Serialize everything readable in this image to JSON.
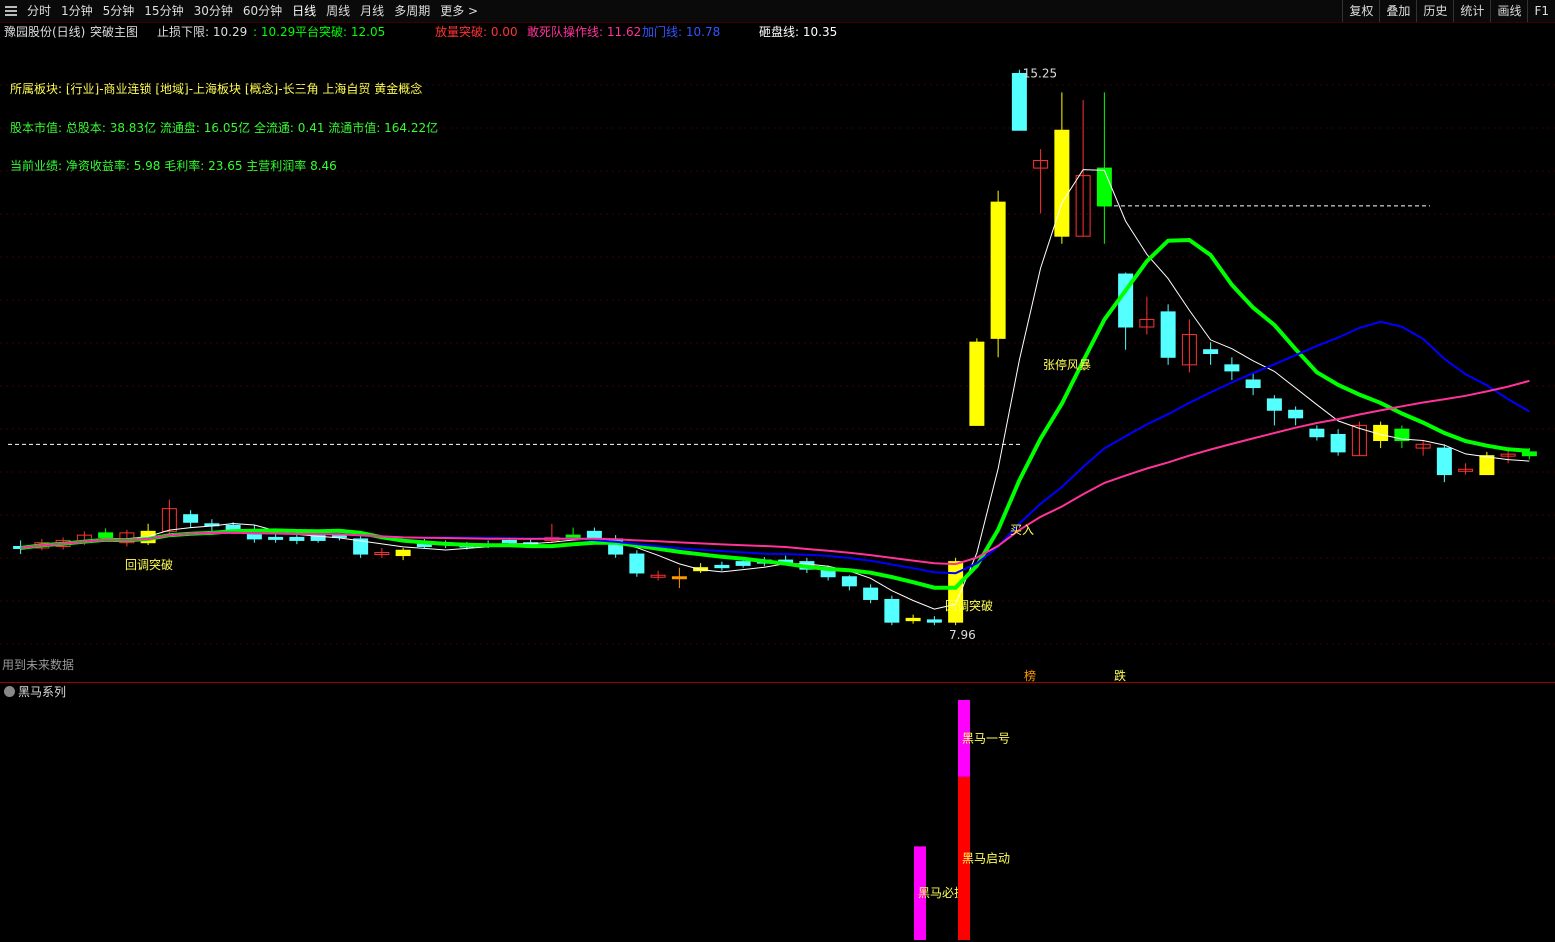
{
  "toolbar": {
    "periods": [
      "分时",
      "1分钟",
      "5分钟",
      "15分钟",
      "30分钟",
      "60分钟",
      "日线",
      "周线",
      "月线",
      "多周期",
      "更多 >"
    ],
    "active_period": "日线",
    "right_buttons": [
      "复权",
      "叠加",
      "历史",
      "统计",
      "画线",
      "F1"
    ]
  },
  "info": {
    "stock": "豫园股份(日线)",
    "indicator": "突破主图",
    "stop_loss": "止损下限: 10.29",
    "support": ": 10.29",
    "platform_breakout": "平台突破: 12.05",
    "volume_breakout": "放量突破: 0.00",
    "dare_line": "敢死队操作线: 11.62",
    "accelerate_line": "加门线: 10.78",
    "smash_line": "砸盘线: 10.35"
  },
  "notes": {
    "sector": "所属板块: [行业]-商业连锁 [地域]-上海板块 [概念]-长三角 上海自贸 黄金概念",
    "capital": "股本市值: 总股本: 38.83亿 流通盘: 16.05亿 全流通: 0.41 流通市值: 164.22亿",
    "performance": "当前业绩: 净资收益率: 5.98 毛利率: 23.65 主营利润率 8.46"
  },
  "future_data_note": "用到未来数据",
  "sub_panel_title": "黑马系列",
  "colors": {
    "up_candle": "#ff3232",
    "down_candle": "#54ffff",
    "yellow": "#ffff00",
    "green_line": "#00ff00",
    "blue_line": "#0000ff",
    "pink_line": "#ff3399",
    "magenta": "#ff00ff",
    "red_bar": "#ff0000"
  },
  "chart_data": {
    "type": "candlestick",
    "y_range": [
      7.5,
      15.6
    ],
    "high_label": "15.25",
    "low_label": "7.96",
    "dashed_levels": [
      10.35,
      13.5
    ],
    "candles": [
      [
        9.0,
        8.98,
        9.08,
        8.9
      ],
      [
        8.98,
        9.05,
        9.1,
        8.95
      ],
      [
        9.0,
        9.08,
        9.12,
        8.96
      ],
      [
        9.06,
        9.15,
        9.2,
        9.02
      ],
      [
        9.12,
        9.18,
        9.24,
        9.08
      ],
      [
        9.18,
        9.05,
        9.22,
        9.0
      ],
      [
        9.05,
        9.2,
        9.3,
        9.02
      ],
      [
        9.2,
        9.5,
        9.62,
        9.15
      ],
      [
        9.42,
        9.32,
        9.48,
        9.25
      ],
      [
        9.3,
        9.28,
        9.36,
        9.2
      ],
      [
        9.28,
        9.22,
        9.32,
        9.18
      ],
      [
        9.22,
        9.1,
        9.28,
        9.05
      ],
      [
        9.1,
        9.12,
        9.18,
        9.05
      ],
      [
        9.12,
        9.08,
        9.16,
        9.03
      ],
      [
        9.08,
        9.15,
        9.2,
        9.05
      ],
      [
        9.15,
        9.12,
        9.18,
        9.08
      ],
      [
        9.1,
        8.9,
        9.15,
        8.85
      ],
      [
        8.9,
        8.92,
        8.98,
        8.85
      ],
      [
        8.95,
        8.88,
        8.98,
        8.82
      ],
      [
        9.0,
        9.05,
        9.1,
        8.98
      ],
      [
        9.05,
        9.02,
        9.08,
        8.98
      ],
      [
        9.02,
        9.0,
        9.06,
        8.96
      ],
      [
        9.0,
        9.03,
        9.08,
        8.98
      ],
      [
        9.05,
        9.08,
        9.12,
        9.0
      ],
      [
        9.02,
        9.05,
        9.1,
        9.0
      ],
      [
        9.08,
        9.12,
        9.3,
        9.05
      ],
      [
        9.12,
        9.15,
        9.25,
        9.1
      ],
      [
        9.2,
        9.1,
        9.25,
        9.05
      ],
      [
        9.1,
        8.9,
        9.15,
        8.85
      ],
      [
        8.9,
        8.65,
        8.95,
        8.6
      ],
      [
        8.6,
        8.62,
        8.68,
        8.55
      ],
      [
        8.6,
        8.58,
        8.72,
        8.45
      ],
      [
        8.68,
        8.72,
        8.78,
        8.65
      ],
      [
        8.72,
        8.75,
        8.8,
        8.68
      ],
      [
        8.75,
        8.8,
        8.85,
        8.72
      ],
      [
        8.82,
        8.78,
        8.86,
        8.74
      ],
      [
        8.78,
        8.82,
        8.88,
        8.75
      ],
      [
        8.8,
        8.7,
        8.85,
        8.65
      ],
      [
        8.7,
        8.6,
        8.75,
        8.55
      ],
      [
        8.6,
        8.48,
        8.62,
        8.42
      ],
      [
        8.45,
        8.3,
        8.5,
        8.25
      ],
      [
        8.3,
        8.0,
        8.35,
        7.96
      ],
      [
        8.02,
        8.05,
        8.1,
        7.98
      ],
      [
        8.0,
        8.03,
        8.08,
        7.96
      ],
      [
        8.0,
        8.8,
        8.85,
        7.96
      ],
      [
        10.6,
        11.7,
        11.75,
        10.6
      ],
      [
        11.75,
        13.55,
        13.7,
        11.5
      ],
      [
        14.5,
        15.25,
        15.3,
        14.5
      ],
      [
        14.0,
        14.1,
        14.25,
        13.4
      ],
      [
        14.5,
        13.1,
        15.0,
        13.0
      ],
      [
        13.1,
        13.9,
        14.9,
        13.1
      ],
      [
        14.0,
        13.5,
        15.0,
        13.0
      ],
      [
        12.6,
        11.9,
        12.62,
        11.6
      ],
      [
        12.0,
        11.9,
        12.3,
        11.8
      ],
      [
        12.1,
        11.5,
        12.2,
        11.4
      ],
      [
        11.4,
        11.8,
        12.0,
        11.3
      ],
      [
        11.6,
        11.55,
        11.7,
        11.4
      ],
      [
        11.4,
        11.32,
        11.5,
        11.2
      ],
      [
        11.2,
        11.1,
        11.3,
        11.0
      ],
      [
        10.95,
        10.8,
        11.0,
        10.6
      ],
      [
        10.8,
        10.7,
        10.85,
        10.6
      ],
      [
        10.55,
        10.45,
        10.6,
        10.4
      ],
      [
        10.48,
        10.25,
        10.55,
        10.2
      ],
      [
        10.2,
        10.6,
        10.65,
        10.2
      ],
      [
        10.6,
        10.4,
        10.65,
        10.3
      ],
      [
        10.55,
        10.4,
        10.6,
        10.3
      ],
      [
        10.3,
        10.35,
        10.4,
        10.2
      ],
      [
        10.3,
        9.95,
        10.35,
        9.85
      ],
      [
        10.0,
        10.02,
        10.1,
        9.95
      ],
      [
        9.95,
        10.2,
        10.25,
        9.95
      ],
      [
        10.2,
        10.22,
        10.28,
        10.1
      ],
      [
        10.2,
        10.25,
        10.3,
        10.15
      ]
    ],
    "candle_colors": [
      "d",
      "u",
      "u",
      "u",
      "g",
      "u",
      "y",
      "u",
      "d",
      "d",
      "d",
      "d",
      "d",
      "d",
      "d",
      "d",
      "d",
      "u",
      "y",
      "d",
      "d",
      "d",
      "d",
      "d",
      "d",
      "u",
      "g",
      "d",
      "d",
      "d",
      "u",
      "o",
      "y",
      "d",
      "d",
      "d",
      "d",
      "d",
      "d",
      "d",
      "d",
      "d",
      "y",
      "d",
      "y",
      "y",
      "y",
      "d",
      "u",
      "y",
      "u",
      "g",
      "d",
      "u",
      "d",
      "u",
      "d",
      "d",
      "d",
      "d",
      "d",
      "d",
      "d",
      "u",
      "y",
      "g",
      "u",
      "d",
      "u",
      "y",
      "u",
      "g"
    ],
    "annotations": [
      "张停风暴",
      "买入",
      "回调突破",
      "回调突破",
      "榜",
      "跌"
    ],
    "sub_bars": [
      {
        "label": "黑马必抓",
        "color": "magenta",
        "from": 0,
        "to": 0.39
      },
      {
        "label": "黑马启动",
        "color": "red",
        "from": 0,
        "to": 0.68
      },
      {
        "label": "黑马一号",
        "color": "magenta",
        "from": 0.68,
        "to": 1.0
      }
    ]
  }
}
